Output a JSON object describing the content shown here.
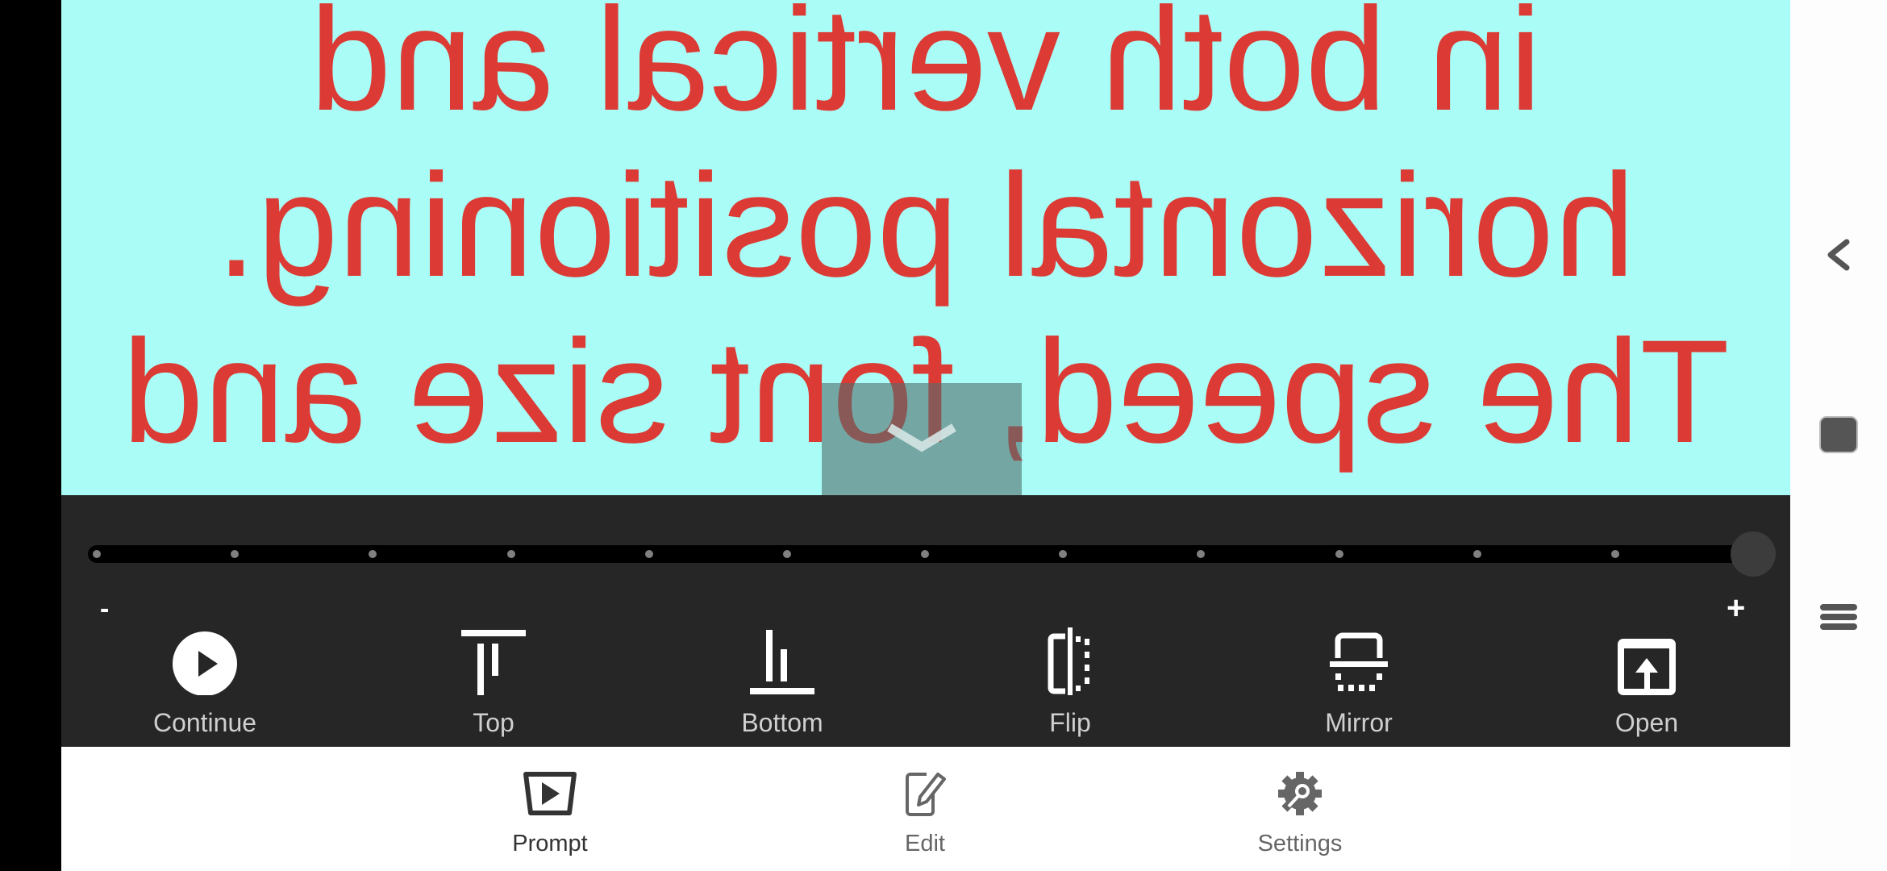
{
  "prompter": {
    "mirrored": true,
    "text_color": "#dc3a34",
    "background_color": "#aafdf6",
    "lines": [
      "in both vertical and",
      "horizontal positioning.",
      "The speed, font size and"
    ],
    "collapse_icon": "chevron-down-icon"
  },
  "speed_slider": {
    "min_label": "-",
    "max_label": "+",
    "steps": 12,
    "value": 12
  },
  "toolbar": {
    "items": [
      {
        "label": "Continue",
        "icon": "play-circle-icon"
      },
      {
        "label": "Top",
        "icon": "align-top-icon"
      },
      {
        "label": "Bottom",
        "icon": "align-bottom-icon"
      },
      {
        "label": "Flip",
        "icon": "flip-icon"
      },
      {
        "label": "Mirror",
        "icon": "mirror-icon"
      },
      {
        "label": "Open",
        "icon": "open-file-icon"
      }
    ]
  },
  "bottom_nav": {
    "active": "Prompt",
    "items": [
      {
        "label": "Prompt",
        "icon": "prompt-play-icon",
        "color": "#333333"
      },
      {
        "label": "Edit",
        "icon": "edit-icon",
        "color": "#666666"
      },
      {
        "label": "Settings",
        "icon": "settings-gear-icon",
        "color": "#666666"
      }
    ]
  },
  "system_nav": {
    "items": [
      {
        "icon": "back-icon"
      },
      {
        "icon": "home-icon"
      },
      {
        "icon": "recents-icon"
      }
    ]
  }
}
